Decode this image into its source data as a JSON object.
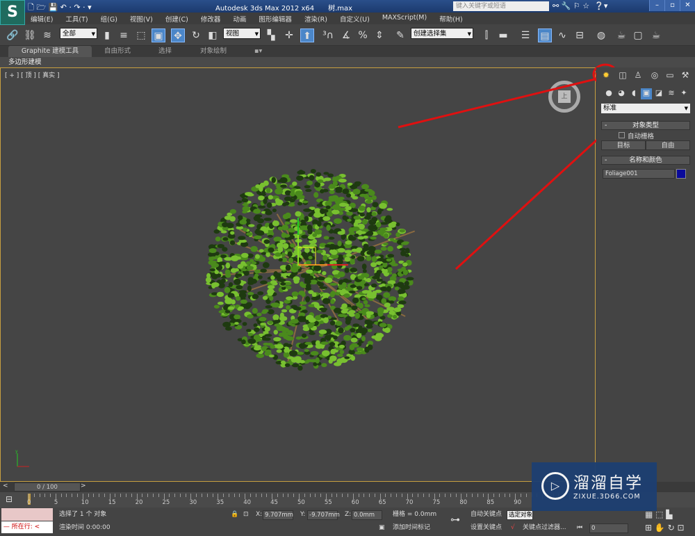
{
  "app": {
    "title": "Autodesk 3ds Max  2012 x64",
    "file": "树.max",
    "search_placeholder": "键入关键字或短语",
    "logo": "S"
  },
  "menu": [
    "编辑(E)",
    "工具(T)",
    "组(G)",
    "视图(V)",
    "创建(C)",
    "修改器",
    "动画",
    "图形编辑器",
    "渲染(R)",
    "自定义(U)",
    "MAXScript(M)",
    "帮助(H)"
  ],
  "toolbar": {
    "selection_filter": "全部",
    "ref_coord": "视图",
    "named_selection": "创建选择集"
  },
  "ribbon": {
    "tabs": [
      "Graphite 建模工具",
      "自由形式",
      "选择",
      "对象绘制"
    ],
    "active_tab": "Graphite 建模工具",
    "sub": "多边形建模"
  },
  "viewport": {
    "label": "[ + ] [ 顶 ] [ 真实 ]",
    "viewcube_face": "上"
  },
  "panel": {
    "category": "标准",
    "object_type_header": "对象类型",
    "auto_grid": "自动栅格",
    "buttons": [
      "目标",
      "自由"
    ],
    "name_color_header": "名称和颜色",
    "object_name": "Foliage001",
    "object_color": "#0a0a9a"
  },
  "timeline": {
    "frame": "0 / 100",
    "ticks": [
      "0",
      "5",
      "10",
      "15",
      "20",
      "25",
      "30",
      "35",
      "40",
      "45",
      "50",
      "55",
      "60",
      "65",
      "70",
      "75",
      "80",
      "85",
      "90"
    ]
  },
  "status": {
    "selection": "选择了 1 个 对象",
    "render_time": "渲染时间 0:00:00",
    "x_label": "X:",
    "x": "9.707mm",
    "y_label": "Y:",
    "y": "-9.707mm",
    "z_label": "Z:",
    "z": "0.0mm",
    "grid": "栅格 = 0.0mm",
    "add_time_tag": "添加时间标记",
    "auto_key": "自动关键点",
    "set_key": "设置关键点",
    "selected_obj": "选定对象",
    "key_filters": "关键点过滤器...",
    "frame_field": "0",
    "maxscript": "所在行:"
  },
  "watermark": {
    "brand": "溜溜自学",
    "url": "ZIXUE.3D66.COM"
  },
  "colors": {
    "annotation": "#e01010",
    "viewport_border": "#c8a040",
    "active_button": "#4b86c8"
  }
}
